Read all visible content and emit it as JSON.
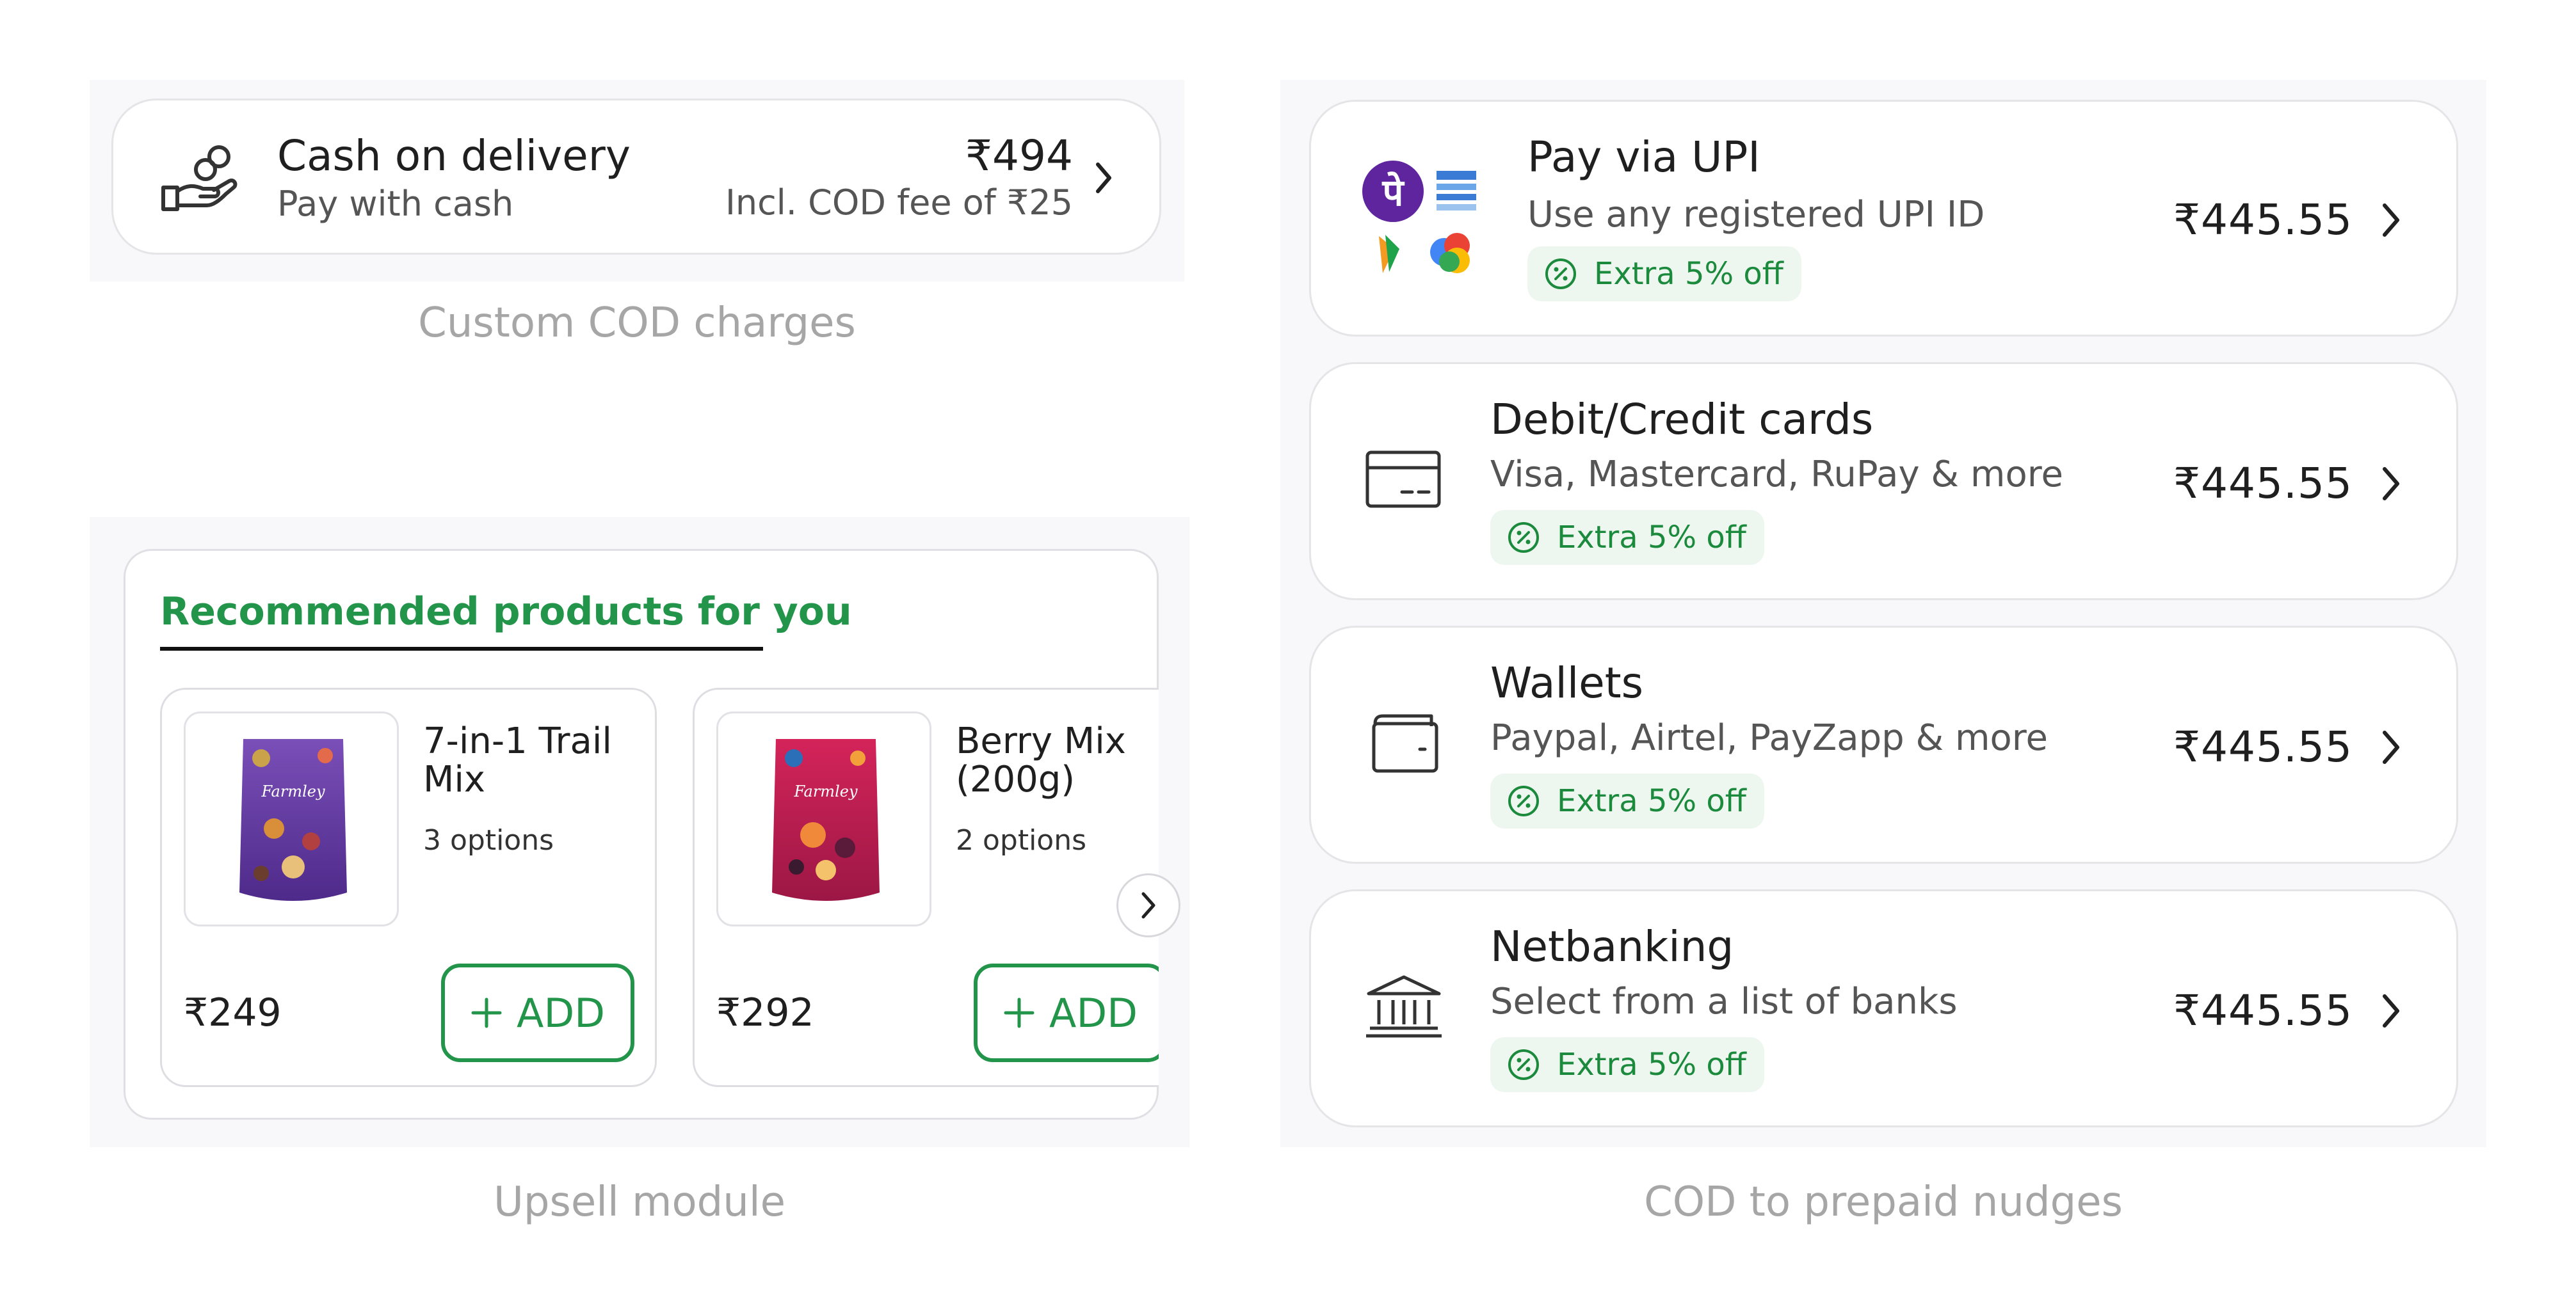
{
  "captions": {
    "cod": "Custom COD charges",
    "upsell": "Upsell module",
    "nudges": "COD to prepaid nudges"
  },
  "cod_option": {
    "title": "Cash on delivery",
    "subtitle": "Pay with cash",
    "price": "₹494",
    "fee_note": "Incl. COD fee of ₹25",
    "icon": "cash-hand-icon"
  },
  "upsell": {
    "heading": "Recommended products for you",
    "products": [
      {
        "name_line1": "7-in-1 Trail",
        "name_line2": "Mix",
        "options": "3 options",
        "price": "₹249",
        "add_label": "ADD",
        "pouch_brand": "Farmley"
      },
      {
        "name_line1": "Berry Mix",
        "name_line2": "(200g)",
        "options": "2 options",
        "price": "₹292",
        "add_label": "ADD",
        "pouch_brand": "Farmley"
      }
    ],
    "next_icon": "chevron-right-icon"
  },
  "payment_methods": [
    {
      "title": "Pay via UPI",
      "subtitle": "Use any registered UPI ID",
      "price": "₹445.55",
      "badge": "Extra 5% off",
      "icon": "upi-apps-icon"
    },
    {
      "title": "Debit/Credit cards",
      "subtitle": "Visa, Mastercard, RuPay & more",
      "price": "₹445.55",
      "badge": "Extra 5% off",
      "icon": "card-icon"
    },
    {
      "title": "Wallets",
      "subtitle": "Paypal, Airtel, PayZapp & more",
      "price": "₹445.55",
      "badge": "Extra 5% off",
      "icon": "wallet-icon"
    },
    {
      "title": "Netbanking",
      "subtitle": "Select from a list of banks",
      "price": "₹445.55",
      "badge": "Extra 5% off",
      "icon": "bank-icon"
    }
  ],
  "colors": {
    "accent_green": "#23954a",
    "badge_bg": "#eef7ef",
    "panel_bg": "#f8f7f9",
    "phonepe_purple": "#5f259f"
  }
}
